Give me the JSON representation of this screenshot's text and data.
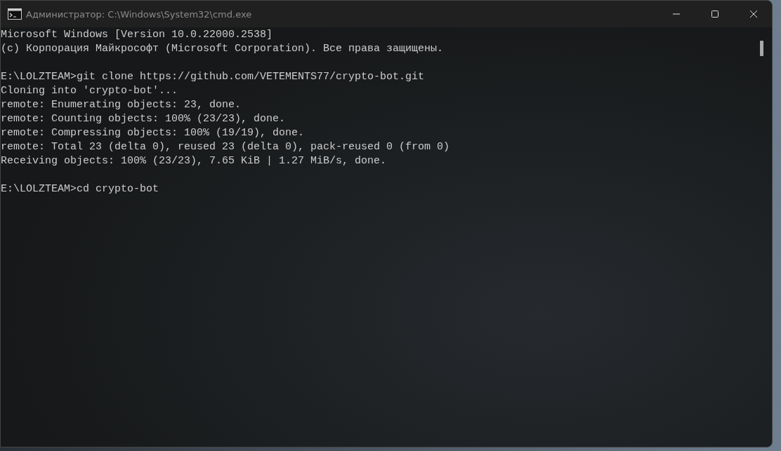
{
  "window": {
    "title": "Администратор: C:\\Windows\\System32\\cmd.exe"
  },
  "console": {
    "blocks": [
      [
        "Microsoft Windows [Version 10.0.22000.2538]",
        "(c) Корпорация Майкрософт (Microsoft Corporation). Все права защищены."
      ],
      [
        "E:\\LOLZTEAM>git clone https://github.com/VETEMENTS77/crypto-bot.git",
        "Cloning into 'crypto-bot'...",
        "remote: Enumerating objects: 23, done.",
        "remote: Counting objects: 100% (23/23), done.",
        "remote: Compressing objects: 100% (19/19), done.",
        "remote: Total 23 (delta 0), reused 23 (delta 0), pack-reused 0 (from 0)",
        "Receiving objects: 100% (23/23), 7.65 KiB | 1.27 MiB/s, done."
      ],
      [
        "E:\\LOLZTEAM>cd crypto-bot"
      ]
    ]
  }
}
